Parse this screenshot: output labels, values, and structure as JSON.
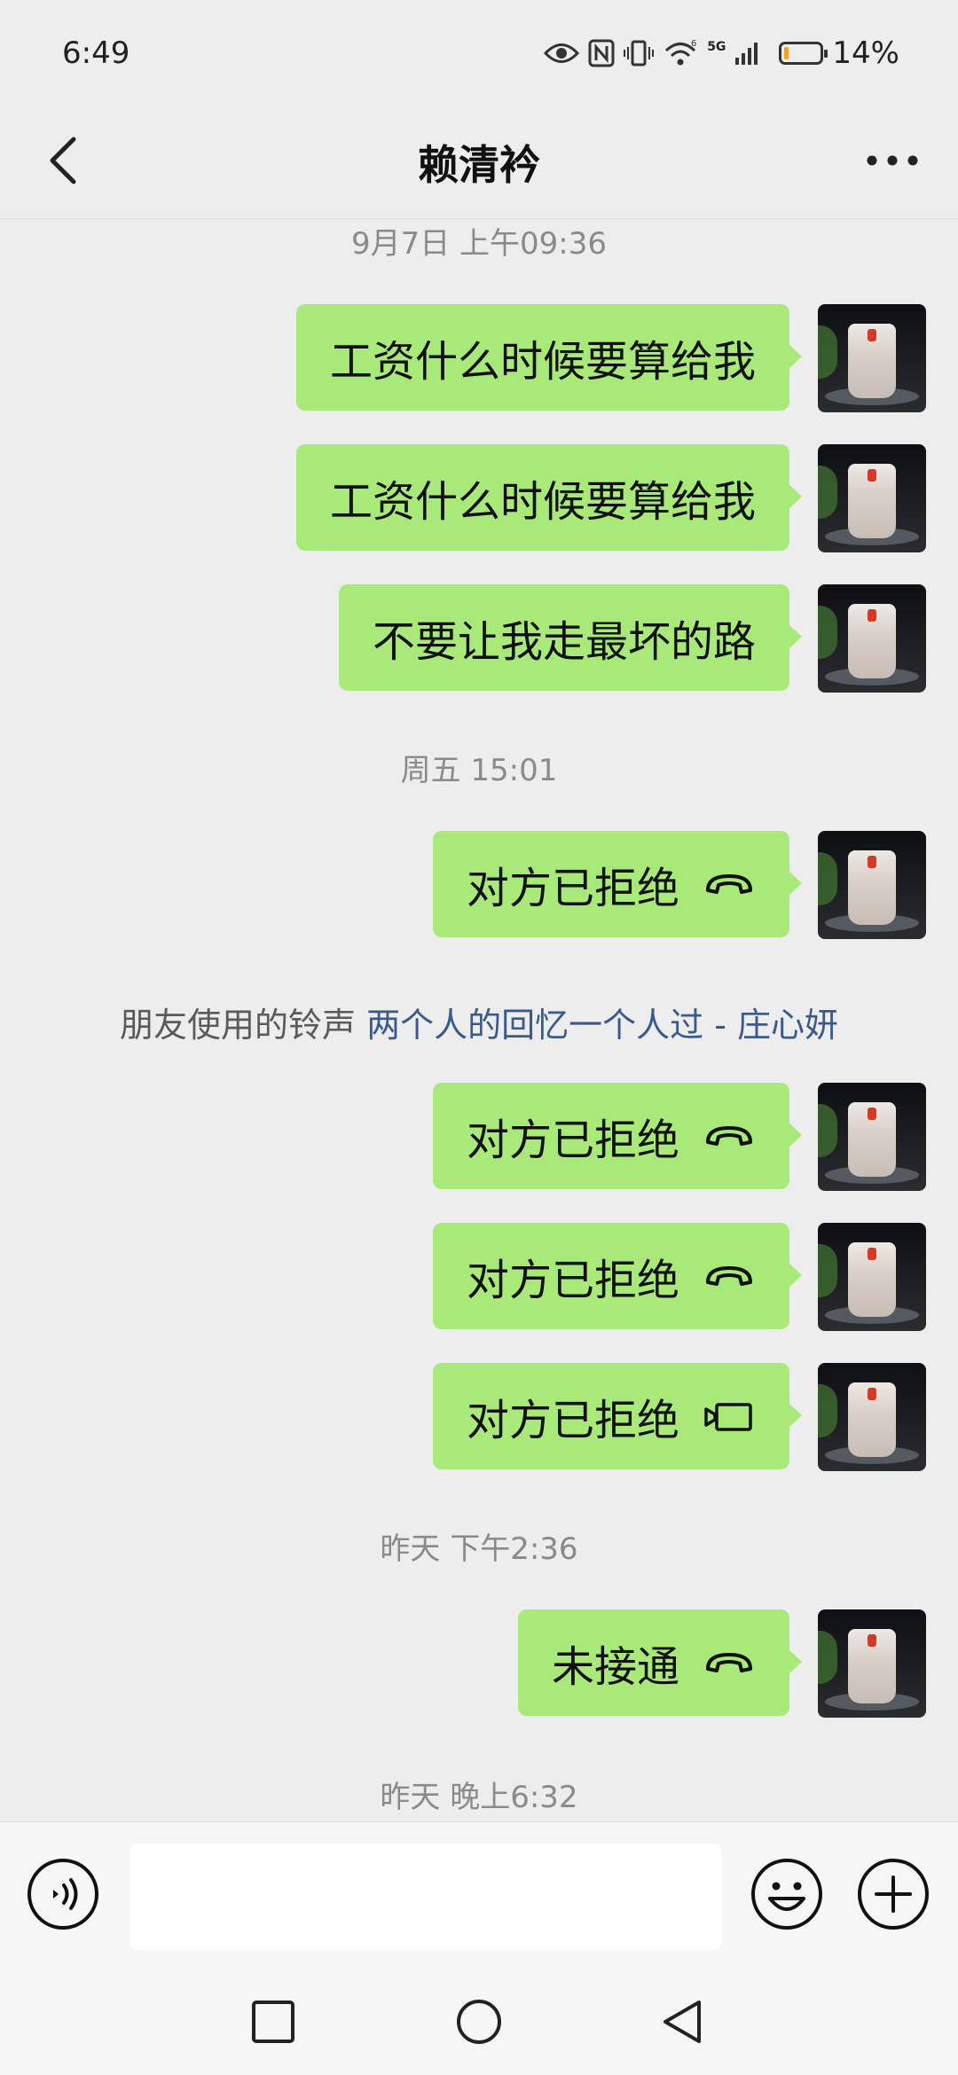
{
  "status_bar": {
    "time": "6:49",
    "network": "5G",
    "battery": "14%",
    "battery_level": 0.14,
    "battery_color": "#f0a030",
    "icons": [
      "eye-icon",
      "nfc-icon",
      "vibrate-icon",
      "wifi-icon",
      "signal-icon",
      "battery-icon"
    ]
  },
  "header": {
    "title": "赖清衿",
    "back_icon": "chevron-left-icon",
    "more_icon": "more-horizontal-icon"
  },
  "colors": {
    "bubble_sent": "#a9e97a",
    "background": "#ededed",
    "link": "#3b5a8c"
  },
  "messages": [
    {
      "type": "timestamp",
      "text": "9月7日 上午09:36"
    },
    {
      "type": "sent",
      "text": "工资什么时候要算给我"
    },
    {
      "type": "sent",
      "text": "工资什么时候要算给我"
    },
    {
      "type": "sent",
      "text": "不要让我走最坏的路"
    },
    {
      "type": "timestamp",
      "text": "周五 15:01"
    },
    {
      "type": "sent_call",
      "text": "对方已拒绝",
      "icon": "phone-hangup-icon"
    },
    {
      "type": "system",
      "prefix": "朋友使用的铃声",
      "song": "两个人的回忆一个人过 - 庄心妍"
    },
    {
      "type": "sent_call",
      "text": "对方已拒绝",
      "icon": "phone-hangup-icon"
    },
    {
      "type": "sent_call",
      "text": "对方已拒绝",
      "icon": "phone-hangup-icon"
    },
    {
      "type": "sent_call",
      "text": "对方已拒绝",
      "icon": "video-call-icon"
    },
    {
      "type": "timestamp",
      "text": "昨天 下午2:36"
    },
    {
      "type": "sent_call",
      "text": "未接通",
      "icon": "phone-hangup-icon"
    },
    {
      "type": "timestamp",
      "text": "昨天 晚上6:32"
    }
  ],
  "input_bar": {
    "value": "",
    "voice_icon": "voice-icon",
    "emoji_icon": "emoji-icon",
    "plus_icon": "plus-icon"
  },
  "nav_bar": {
    "icons": [
      "recent-apps-icon",
      "home-icon",
      "back-triangle-icon"
    ]
  }
}
